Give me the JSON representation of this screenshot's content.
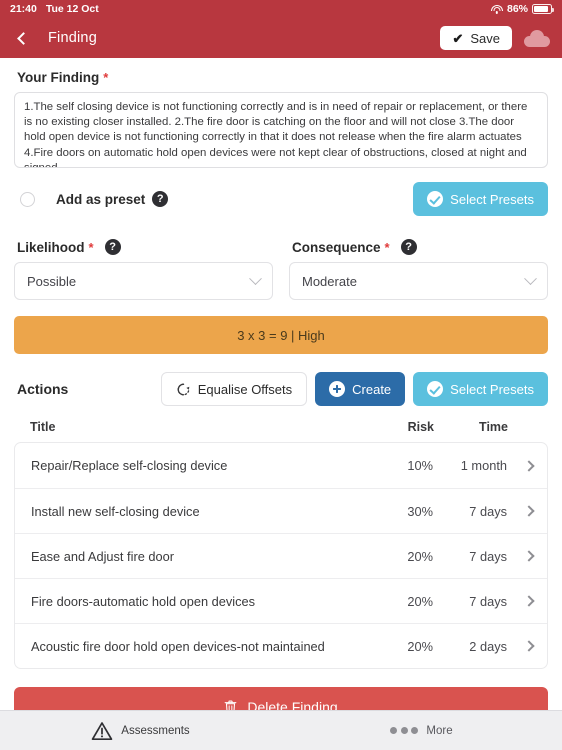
{
  "status_bar": {
    "time": "21:40",
    "date": "Tue 12 Oct",
    "battery_percent": "86%",
    "wifi_icon": "wifi-icon",
    "battery_icon": "battery-icon"
  },
  "navbar": {
    "back_icon": "chevron-left-icon",
    "title": "Finding",
    "save_label": "Save",
    "save_icon": "check-icon",
    "cloud_icon": "cloud-sync-icon"
  },
  "finding": {
    "label": "Your Finding",
    "required_marker": "*",
    "text": "1.The self closing device is not functioning correctly and is in need of repair or replacement, or there is no existing closer installed.\n2.The fire door is catching on the floor and will not close\n3.The door hold open device is not functioning correctly in that it does not release when the fire alarm actuates\n4.Fire doors on automatic hold open devices were not kept clear of obstructions, closed at night and signed"
  },
  "preset": {
    "radio_name": "add-as-preset-radio",
    "label": "Add as preset",
    "help_icon": "question-mark-icon",
    "select_presets_label": "Select Presets",
    "select_presets_icon": "check-circle-icon"
  },
  "likelihood": {
    "label": "Likelihood",
    "required_marker": "*",
    "help_icon": "question-mark-icon",
    "value": "Possible",
    "chevron_icon": "chevron-down-icon"
  },
  "consequence": {
    "label": "Consequence",
    "required_marker": "*",
    "help_icon": "question-mark-icon",
    "value": "Moderate",
    "chevron_icon": "chevron-down-icon"
  },
  "risk_banner": {
    "text": "3 x 3 = 9 | High",
    "color": "#eca54b"
  },
  "actions": {
    "title": "Actions",
    "equalise_label": "Equalise Offsets",
    "equalise_icon": "refresh-icon",
    "create_label": "Create",
    "create_icon": "plus-circle-icon",
    "select_presets_label": "Select Presets",
    "select_presets_icon": "check-circle-icon",
    "columns": [
      "Title",
      "Risk",
      "Time"
    ],
    "rows": [
      {
        "title": "Repair/Replace self-closing device",
        "risk": "10%",
        "time": "1 month",
        "chevron_icon": "chevron-right-icon"
      },
      {
        "title": "Install new self-closing device",
        "risk": "30%",
        "time": "7 days",
        "chevron_icon": "chevron-right-icon"
      },
      {
        "title": "Ease and Adjust fire door",
        "risk": "20%",
        "time": "7 days",
        "chevron_icon": "chevron-right-icon"
      },
      {
        "title": "Fire doors-automatic hold open devices",
        "risk": "20%",
        "time": "7 days",
        "chevron_icon": "chevron-right-icon"
      },
      {
        "title": "Acoustic fire door hold open devices-not maintained",
        "risk": "20%",
        "time": "2 days",
        "chevron_icon": "chevron-right-icon"
      }
    ]
  },
  "delete": {
    "label": "Delete Finding",
    "icon": "trash-icon",
    "color": "#d9534f"
  },
  "tabbar": {
    "assessments_label": "Assessments",
    "assessments_icon": "warning-triangle-icon",
    "more_label": "More",
    "more_icon": "ellipsis-icon"
  },
  "theme": {
    "header": "#b8373f",
    "accent_light_blue": "#5bc0de",
    "accent_blue": "#2c6ca8",
    "danger": "#d9534f",
    "warning": "#eca54b"
  }
}
